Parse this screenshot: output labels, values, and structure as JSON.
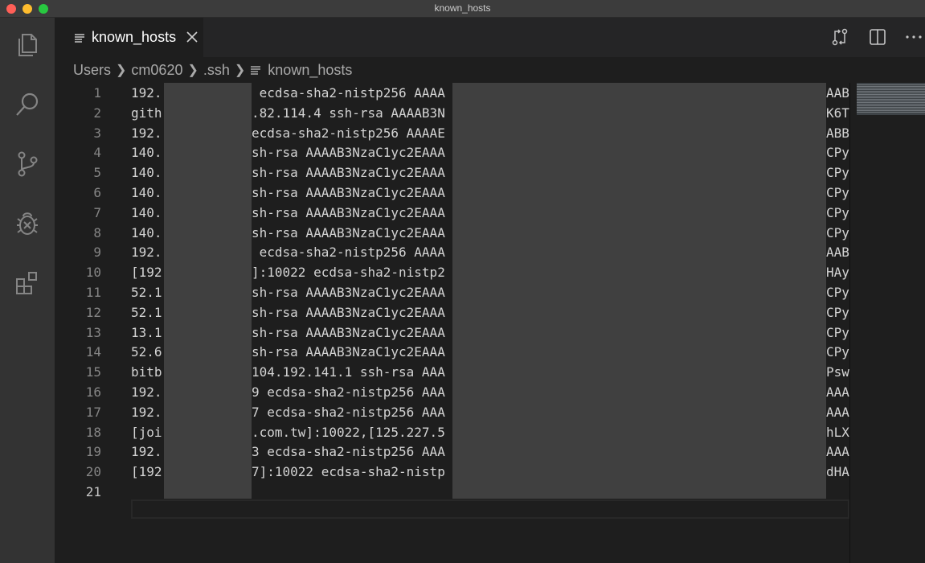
{
  "window": {
    "title": "known_hosts"
  },
  "tabs": [
    {
      "label": "known_hosts"
    }
  ],
  "breadcrumb": {
    "items": [
      "Users",
      "cm0620",
      ".ssh",
      "known_hosts"
    ]
  },
  "editor": {
    "lines": [
      {
        "n": "1",
        "pre": "192.",
        "mid": " ecdsa-sha2-nistp256 AAAA",
        "post": "AAB"
      },
      {
        "n": "2",
        "pre": "gith",
        "mid": ".82.114.4 ssh-rsa AAAAB3N",
        "post": "K6T"
      },
      {
        "n": "3",
        "pre": "192.",
        "mid": "ecdsa-sha2-nistp256 AAAAE",
        "post": "ABB"
      },
      {
        "n": "4",
        "pre": "140.",
        "mid": "sh-rsa AAAAB3NzaC1yc2EAAA",
        "post": "CPy"
      },
      {
        "n": "5",
        "pre": "140.",
        "mid": "sh-rsa AAAAB3NzaC1yc2EAAA",
        "post": "CPy"
      },
      {
        "n": "6",
        "pre": "140.",
        "mid": "sh-rsa AAAAB3NzaC1yc2EAAA",
        "post": "CPy"
      },
      {
        "n": "7",
        "pre": "140.",
        "mid": "sh-rsa AAAAB3NzaC1yc2EAAA",
        "post": "CPy"
      },
      {
        "n": "8",
        "pre": "140.",
        "mid": "sh-rsa AAAAB3NzaC1yc2EAAA",
        "post": "CPy"
      },
      {
        "n": "9",
        "pre": "192.",
        "mid": " ecdsa-sha2-nistp256 AAAA",
        "post": "AAB"
      },
      {
        "n": "10",
        "pre": "[192",
        "mid": "]:10022 ecdsa-sha2-nistp2",
        "post": "HAy"
      },
      {
        "n": "11",
        "pre": "52.1",
        "mid": "sh-rsa AAAAB3NzaC1yc2EAAA",
        "post": "CPy"
      },
      {
        "n": "12",
        "pre": "52.1",
        "mid": "sh-rsa AAAAB3NzaC1yc2EAAA",
        "post": "CPy"
      },
      {
        "n": "13",
        "pre": "13.1",
        "mid": "sh-rsa AAAAB3NzaC1yc2EAAA",
        "post": "CPy"
      },
      {
        "n": "14",
        "pre": "52.6",
        "mid": "sh-rsa AAAAB3NzaC1yc2EAAA",
        "post": "CPy"
      },
      {
        "n": "15",
        "pre": "bitb",
        "mid": "104.192.141.1 ssh-rsa AAA",
        "post": "Psw"
      },
      {
        "n": "16",
        "pre": "192.",
        "mid": "9 ecdsa-sha2-nistp256 AAA",
        "post": "AAA"
      },
      {
        "n": "17",
        "pre": "192.",
        "mid": "7 ecdsa-sha2-nistp256 AAA",
        "post": "AAA"
      },
      {
        "n": "18",
        "pre": "[joi",
        "mid": ".com.tw]:10022,[125.227.5",
        "post": "hLX"
      },
      {
        "n": "19",
        "pre": "192.",
        "mid": "3 ecdsa-sha2-nistp256 AAA",
        "post": "AAA"
      },
      {
        "n": "20",
        "pre": "[192",
        "mid": "7]:10022 ecdsa-sha2-nistp",
        "post": "dHA"
      },
      {
        "n": "21",
        "pre": "",
        "mid": "",
        "post": ""
      }
    ]
  },
  "colors": {
    "background": "#1e1e1e",
    "activitybar": "#333333",
    "tabbar": "#252526",
    "redaction": "#404040",
    "text": "#d4d4d4",
    "line_number": "#858585"
  },
  "icons": [
    "explorer-icon",
    "search-icon",
    "source-control-icon",
    "debug-icon",
    "extensions-icon",
    "file-lines-icon",
    "close-icon",
    "compare-changes-icon",
    "split-editor-icon",
    "more-actions-icon"
  ]
}
